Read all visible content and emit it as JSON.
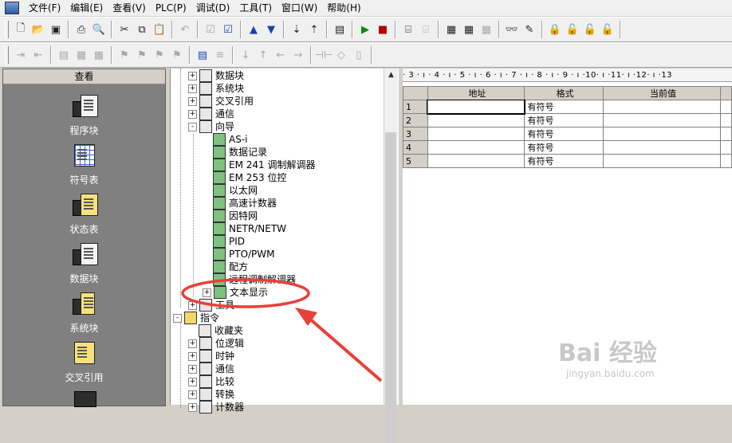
{
  "menu": [
    "文件(F)",
    "编辑(E)",
    "查看(V)",
    "PLC(P)",
    "调试(D)",
    "工具(T)",
    "窗口(W)",
    "帮助(H)"
  ],
  "nav": {
    "header": "查看",
    "items": [
      {
        "label": "程序块",
        "icon": "program-block-icon"
      },
      {
        "label": "符号表",
        "icon": "symbol-table-icon"
      },
      {
        "label": "状态表",
        "icon": "status-table-icon"
      },
      {
        "label": "数据块",
        "icon": "data-block-icon"
      },
      {
        "label": "系统块",
        "icon": "system-block-icon"
      },
      {
        "label": "交叉引用",
        "icon": "cross-reference-icon"
      }
    ]
  },
  "tree": {
    "items": [
      {
        "label": "数据块",
        "level": 1,
        "expander": "+"
      },
      {
        "label": "系统块",
        "level": 1,
        "expander": "+"
      },
      {
        "label": "交叉引用",
        "level": 1,
        "expander": "+"
      },
      {
        "label": "通信",
        "level": 1,
        "expander": "+"
      },
      {
        "label": "向导",
        "level": 1,
        "expander": "-"
      },
      {
        "label": "AS-i",
        "level": 2,
        "expander": ""
      },
      {
        "label": "数据记录",
        "level": 2,
        "expander": ""
      },
      {
        "label": "EM 241 调制解调器",
        "level": 2,
        "expander": ""
      },
      {
        "label": "EM 253 位控",
        "level": 2,
        "expander": ""
      },
      {
        "label": "以太网",
        "level": 2,
        "expander": ""
      },
      {
        "label": "高速计数器",
        "level": 2,
        "expander": ""
      },
      {
        "label": "因特网",
        "level": 2,
        "expander": ""
      },
      {
        "label": "NETR/NETW",
        "level": 2,
        "expander": ""
      },
      {
        "label": "PID",
        "level": 2,
        "expander": ""
      },
      {
        "label": "PTO/PWM",
        "level": 2,
        "expander": ""
      },
      {
        "label": "配方",
        "level": 2,
        "expander": ""
      },
      {
        "label": "远程调制解调器",
        "level": 2,
        "expander": ""
      },
      {
        "label": "文本显示",
        "level": 2,
        "expander": "+"
      },
      {
        "label": "工具",
        "level": 1,
        "expander": "+"
      },
      {
        "label": "指令",
        "level": 0,
        "expander": "-"
      },
      {
        "label": "收藏夹",
        "level": 1,
        "expander": ""
      },
      {
        "label": "位逻辑",
        "level": 1,
        "expander": "+"
      },
      {
        "label": "时钟",
        "level": 1,
        "expander": "+"
      },
      {
        "label": "通信",
        "level": 1,
        "expander": "+"
      },
      {
        "label": "比较",
        "level": 1,
        "expander": "+"
      },
      {
        "label": "转换",
        "level": 1,
        "expander": "+"
      },
      {
        "label": "计数器",
        "level": 1,
        "expander": "+"
      }
    ]
  },
  "ruler": "· 3 · ı · 4 · ı · 5 · ı · 6 · ı · 7 · ı · 8 · ı · 9 · ı ·10· ı ·11· ı ·12· ı ·13",
  "table": {
    "headers": [
      "地址",
      "格式",
      "当前值"
    ],
    "rows": [
      {
        "n": "1",
        "addr": "",
        "fmt": "有符号",
        "cur": ""
      },
      {
        "n": "2",
        "addr": "",
        "fmt": "有符号",
        "cur": ""
      },
      {
        "n": "3",
        "addr": "",
        "fmt": "有符号",
        "cur": ""
      },
      {
        "n": "4",
        "addr": "",
        "fmt": "有符号",
        "cur": ""
      },
      {
        "n": "5",
        "addr": "",
        "fmt": "有符号",
        "cur": ""
      }
    ]
  },
  "watermark": {
    "main": "Bai 经验",
    "sub": "jingyan.baidu.com"
  },
  "colors": {
    "annotation": "#e8403a",
    "nav_bg": "#808080"
  }
}
